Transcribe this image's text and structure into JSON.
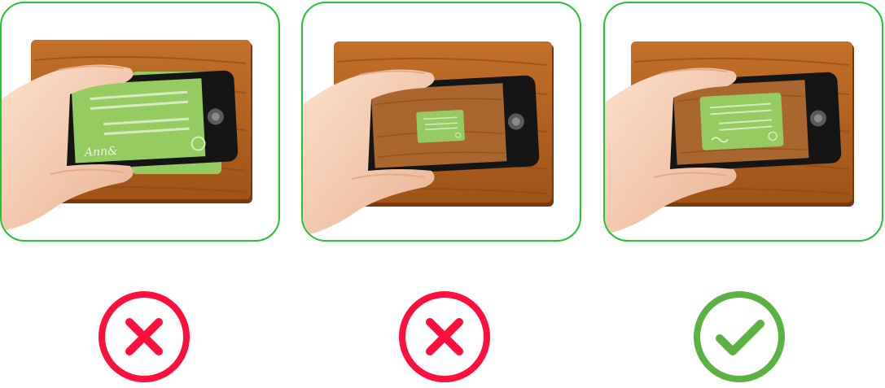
{
  "colors": {
    "panel_border": "#22c531",
    "wood": "#b8641f",
    "wood_dark": "#8e4612",
    "card": "#96cb62",
    "card_light": "#c9e6a8",
    "reject": "#ff0f3c",
    "accept": "#5ab243",
    "skin": "#f7cfb2",
    "phone": "#151515"
  },
  "examples": [
    {
      "id": "too-close",
      "card_signature": "Ann&",
      "result_icon": "x-circle-icon",
      "verdict": "incorrect"
    },
    {
      "id": "too-far",
      "card_signature": "",
      "result_icon": "x-circle-icon",
      "verdict": "incorrect"
    },
    {
      "id": "correct-distance",
      "card_signature": "",
      "result_icon": "check-circle-icon",
      "verdict": "correct"
    }
  ]
}
